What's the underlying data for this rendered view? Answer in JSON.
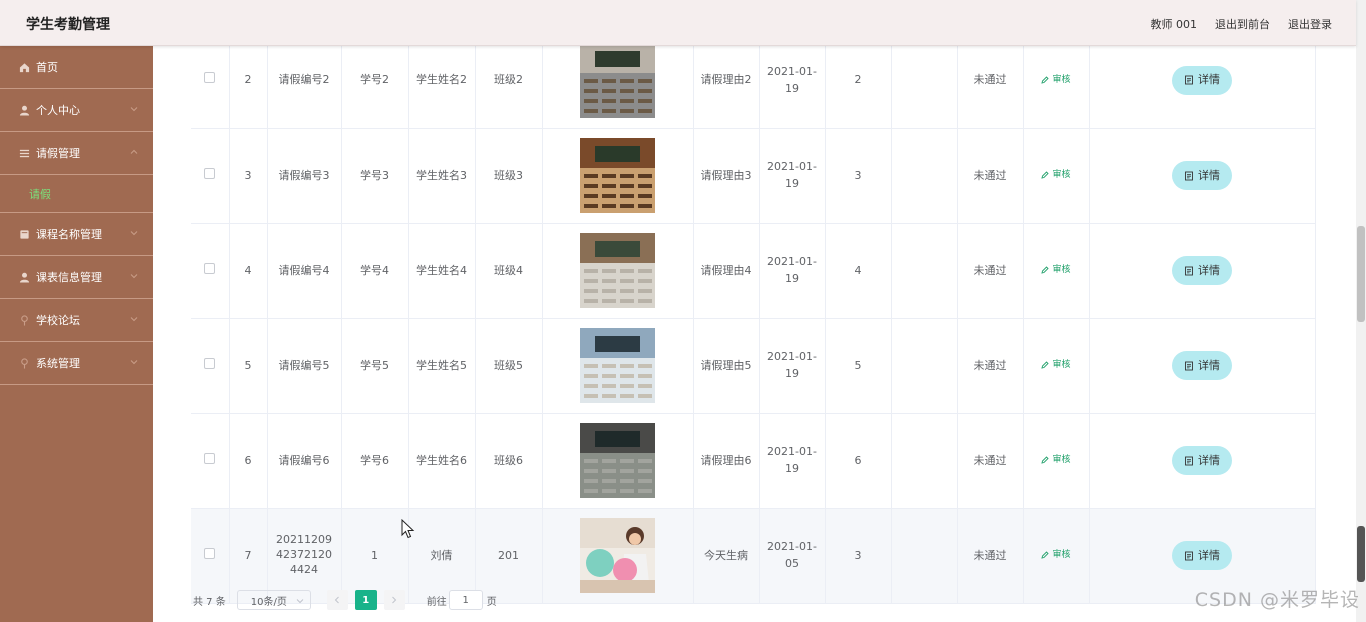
{
  "app": {
    "title": "学生考勤管理"
  },
  "header": {
    "user": "教师 001",
    "front_link": "退出到前台",
    "logout": "退出登录"
  },
  "sidebar": {
    "items": [
      {
        "label": "首页",
        "icon": "home-icon"
      },
      {
        "label": "个人中心",
        "icon": "user-icon"
      },
      {
        "label": "请假管理",
        "icon": "list-icon",
        "expanded": true,
        "sub": "请假"
      },
      {
        "label": "课程名称管理",
        "icon": "book-icon"
      },
      {
        "label": "课表信息管理",
        "icon": "user-icon"
      },
      {
        "label": "学校论坛",
        "icon": "pin-icon"
      },
      {
        "label": "系统管理",
        "icon": "pin-icon"
      }
    ],
    "active_sub": "请假"
  },
  "table": {
    "rows": [
      {
        "idx": "2",
        "leave_no": "请假编号2",
        "student_no": "学号2",
        "student_name": "学生姓名2",
        "class": "班级2",
        "image": "classroom-photo",
        "reason": "请假理由2",
        "date": "2021-01-19",
        "days": "2",
        "status": "未通过",
        "audit": "审核",
        "detail": "详情"
      },
      {
        "idx": "3",
        "leave_no": "请假编号3",
        "student_no": "学号3",
        "student_name": "学生姓名3",
        "class": "班级3",
        "image": "classroom-photo",
        "reason": "请假理由3",
        "date": "2021-01-19",
        "days": "3",
        "status": "未通过",
        "audit": "审核",
        "detail": "详情"
      },
      {
        "idx": "4",
        "leave_no": "请假编号4",
        "student_no": "学号4",
        "student_name": "学生姓名4",
        "class": "班级4",
        "image": "classroom-photo",
        "reason": "请假理由4",
        "date": "2021-01-19",
        "days": "4",
        "status": "未通过",
        "audit": "审核",
        "detail": "详情"
      },
      {
        "idx": "5",
        "leave_no": "请假编号5",
        "student_no": "学号5",
        "student_name": "学生姓名5",
        "class": "班级5",
        "image": "classroom-photo",
        "reason": "请假理由5",
        "date": "2021-01-19",
        "days": "5",
        "status": "未通过",
        "audit": "审核",
        "detail": "详情"
      },
      {
        "idx": "6",
        "leave_no": "请假编号6",
        "student_no": "学号6",
        "student_name": "学生姓名6",
        "class": "班级6",
        "image": "classroom-photo",
        "reason": "请假理由6",
        "date": "2021-01-19",
        "days": "6",
        "status": "未通过",
        "audit": "审核",
        "detail": "详情"
      },
      {
        "idx": "7",
        "leave_no": "20211209423721204424",
        "student_no": "1",
        "student_name": "刘倩",
        "class": "201",
        "image": "person-photo",
        "reason": "今天生病",
        "date": "2021-01-05",
        "days": "3",
        "status": "未通过",
        "audit": "审核",
        "detail": "详情"
      }
    ]
  },
  "pagination": {
    "total": "共 7 条",
    "page_size": "10条/页",
    "current_page": "1",
    "goto_label": "前往",
    "goto_value": "1",
    "page_unit": "页"
  },
  "watermark": "CSDN @米罗毕设",
  "colors": {
    "sidebar": "#a06a51",
    "accent": "#18b38a",
    "detail_button": "#b5eaf0",
    "submenu_active": "#7be07b"
  }
}
